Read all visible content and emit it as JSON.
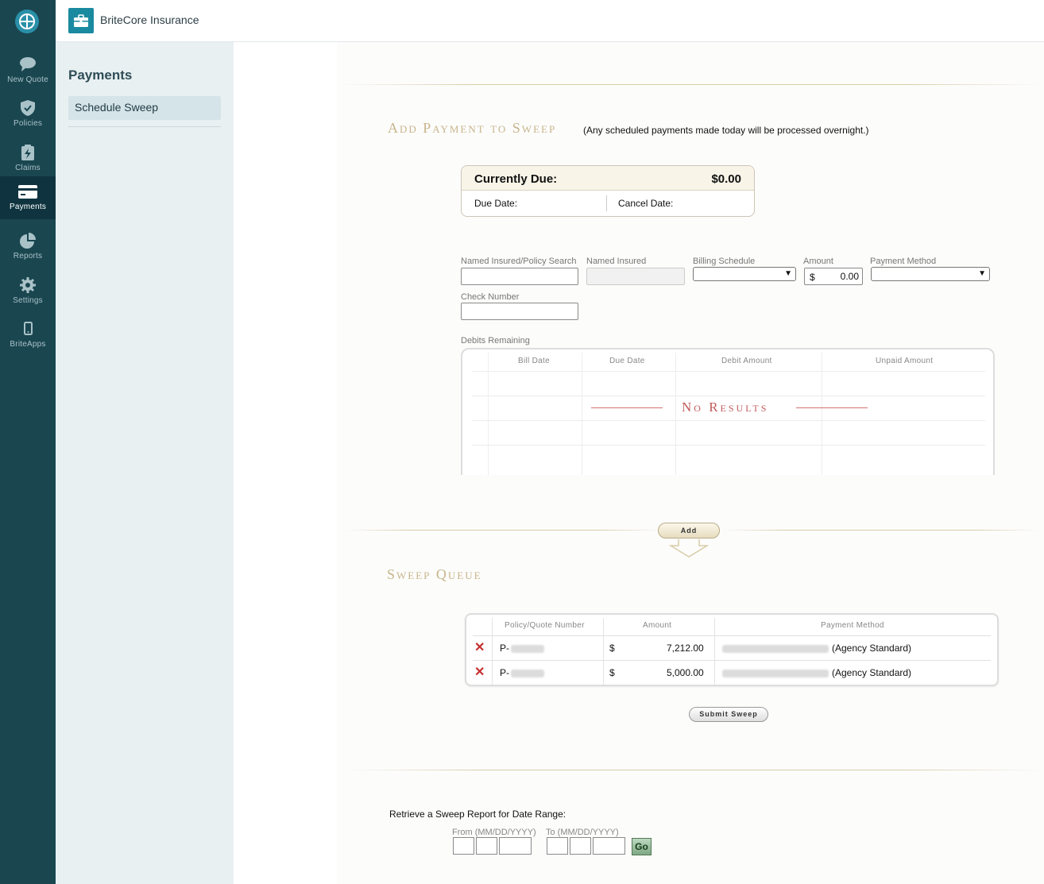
{
  "app": {
    "name": "BriteCore Insurance"
  },
  "rail": {
    "items": [
      {
        "label": "New Quote",
        "icon": "chat-bubble-icon"
      },
      {
        "label": "Policies",
        "icon": "shield-check-icon"
      },
      {
        "label": "Claims",
        "icon": "clipboard-bolt-icon"
      },
      {
        "label": "Payments",
        "icon": "credit-card-icon",
        "active": true
      },
      {
        "label": "Reports",
        "icon": "pie-chart-icon"
      },
      {
        "label": "Settings",
        "icon": "gear-icon"
      },
      {
        "label": "BriteApps",
        "icon": "phone-icon"
      }
    ]
  },
  "sidebar": {
    "title": "Payments",
    "items": [
      {
        "label": "Schedule Sweep",
        "active": true
      }
    ]
  },
  "add_section": {
    "title": "Add Payment to Sweep",
    "note": "(Any scheduled payments made today will be processed overnight.)",
    "currently_due_label": "Currently Due:",
    "currently_due_value": "$0.00",
    "due_date_label": "Due Date:",
    "cancel_date_label": "Cancel Date:"
  },
  "form": {
    "named_insured_search_label": "Named Insured/Policy Search",
    "named_insured_search_value": "",
    "named_insured_label": "Named Insured",
    "named_insured_value": "",
    "billing_schedule_label": "Billing Schedule",
    "billing_schedule_value": "",
    "amount_label": "Amount",
    "amount_currency": "$",
    "amount_value": "0.00",
    "payment_method_label": "Payment Method",
    "payment_method_value": "",
    "check_number_label": "Check Number",
    "check_number_value": ""
  },
  "debits": {
    "label": "Debits Remaining",
    "columns": [
      "Bill Date",
      "Due Date",
      "Debit Amount",
      "Unpaid Amount"
    ],
    "empty_message": "No Results"
  },
  "add_button_label": "Add",
  "queue": {
    "title": "Sweep Queue",
    "columns": [
      "Policy/Quote Number",
      "Amount",
      "Payment Method"
    ],
    "rows": [
      {
        "policy": "P-",
        "currency": "$",
        "amount": "7,212.00",
        "method": "(Agency Standard)"
      },
      {
        "policy": "P-",
        "currency": "$",
        "amount": "5,000.00",
        "method": "(Agency Standard)"
      }
    ]
  },
  "submit_button_label": "Submit Sweep",
  "report": {
    "label": "Retrieve a Sweep Report for Date Range:",
    "from_label": "From (MM/DD/YYYY)",
    "to_label": "To (MM/DD/YYYY)",
    "go_label": "Go"
  },
  "colors": {
    "rail_bg": "#1a4650",
    "accent": "#1a8aa0",
    "section_title": "#c8b58b",
    "no_results": "#c25b5b",
    "delete_x": "#c53030"
  }
}
